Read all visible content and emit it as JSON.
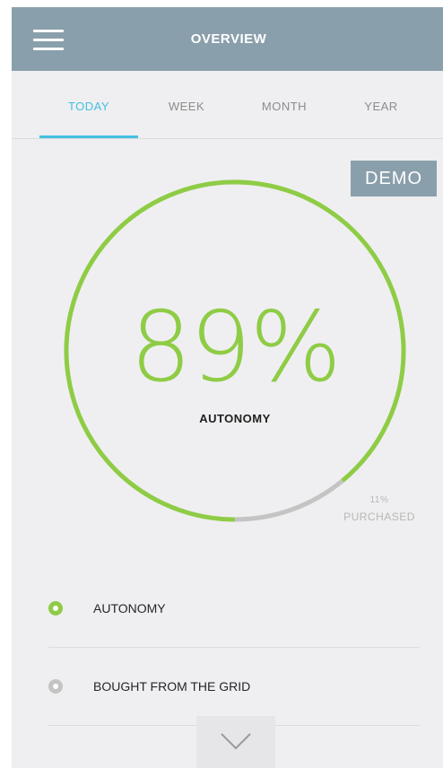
{
  "header": {
    "title": "OVERVIEW"
  },
  "tabs": [
    {
      "label": "TODAY",
      "active": true
    },
    {
      "label": "WEEK",
      "active": false
    },
    {
      "label": "MONTH",
      "active": false
    },
    {
      "label": "YEAR",
      "active": false
    }
  ],
  "demo_label": "DEMO",
  "gauge": {
    "value_text": "89%",
    "label": "AUTONOMY",
    "autonomy_fraction": 0.89,
    "purchased_fraction": 0.11,
    "purchased_pct": "11%",
    "purchased_label": "PURCHASED"
  },
  "legend": [
    {
      "label": "AUTONOMY",
      "color": "#8fcc46"
    },
    {
      "label": "BOUGHT FROM THE GRID",
      "color": "#c4c4c4"
    }
  ],
  "colors": {
    "accent": "#44c0e0",
    "autonomy": "#8fcc46",
    "purchased": "#c4c4c4",
    "header": "#8a9fac"
  },
  "icons": {
    "menu": "hamburger-icon",
    "expand": "chevron-down-icon"
  }
}
